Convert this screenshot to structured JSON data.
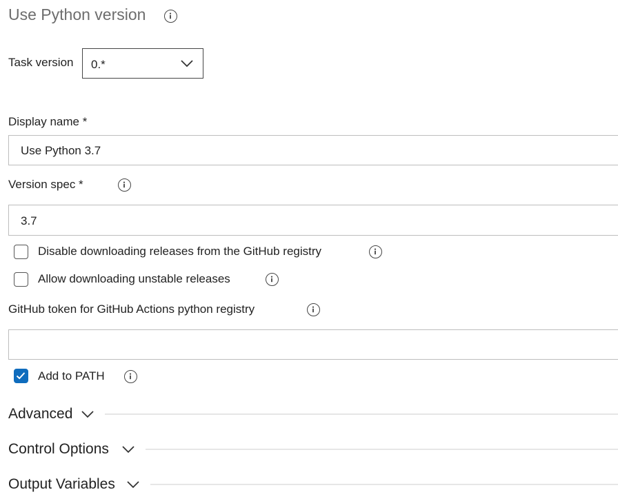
{
  "task": {
    "title": "Use Python version",
    "version_label": "Task version",
    "version_value": "0.*"
  },
  "fields": {
    "display_name_label": "Display name *",
    "display_name_value": "Use Python 3.7",
    "version_spec_label": "Version spec *",
    "version_spec_value": "3.7",
    "disable_downloading_label": "Disable downloading releases from the GitHub registry",
    "allow_unstable_label": "Allow downloading unstable releases",
    "github_token_label": "GitHub token for GitHub Actions python registry",
    "github_token_value": "",
    "add_to_path_label": "Add to PATH"
  },
  "checkboxes": {
    "disable_downloading": false,
    "allow_unstable": false,
    "add_to_path": true
  },
  "sections": {
    "advanced": "Advanced",
    "control_options": "Control Options",
    "output_variables": "Output Variables"
  },
  "icons": {
    "info": "info-icon",
    "chevron": "chevron-down-icon",
    "check": "checkmark-icon"
  },
  "colors": {
    "accent": "#0f6cbd",
    "title": "#6d6d6d",
    "text": "#222222",
    "field_border": "#bdbdbd",
    "divider": "#e6e6e6"
  }
}
